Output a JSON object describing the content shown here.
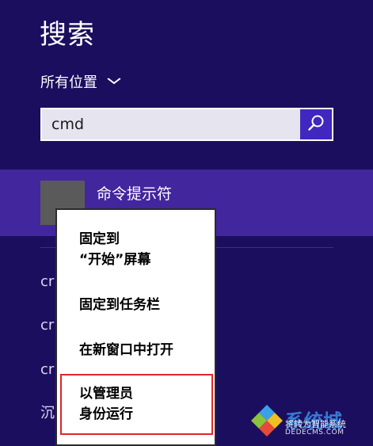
{
  "header": {
    "title": "搜索"
  },
  "scope": {
    "label": "所有位置"
  },
  "search": {
    "value": "cmd"
  },
  "result": {
    "label": "命令提示符"
  },
  "partial_results": [
    "cr",
    "cr",
    "cr",
    "沉"
  ],
  "context_menu": {
    "items": [
      {
        "label": "固定到\n“开始”屏幕"
      },
      {
        "label": "固定到任务栏"
      },
      {
        "label": "在新窗口中打开"
      },
      {
        "label": "以管理员\n身份运行"
      }
    ]
  },
  "watermark": {
    "brand": "系统城",
    "tagline": "将转为智能系统",
    "url": "DEDECMS.COM"
  },
  "colors": {
    "background": "#1c0e5e",
    "selected_row": "#42269e",
    "search_button": "#3f27c0",
    "highlight": "#e0262a"
  }
}
